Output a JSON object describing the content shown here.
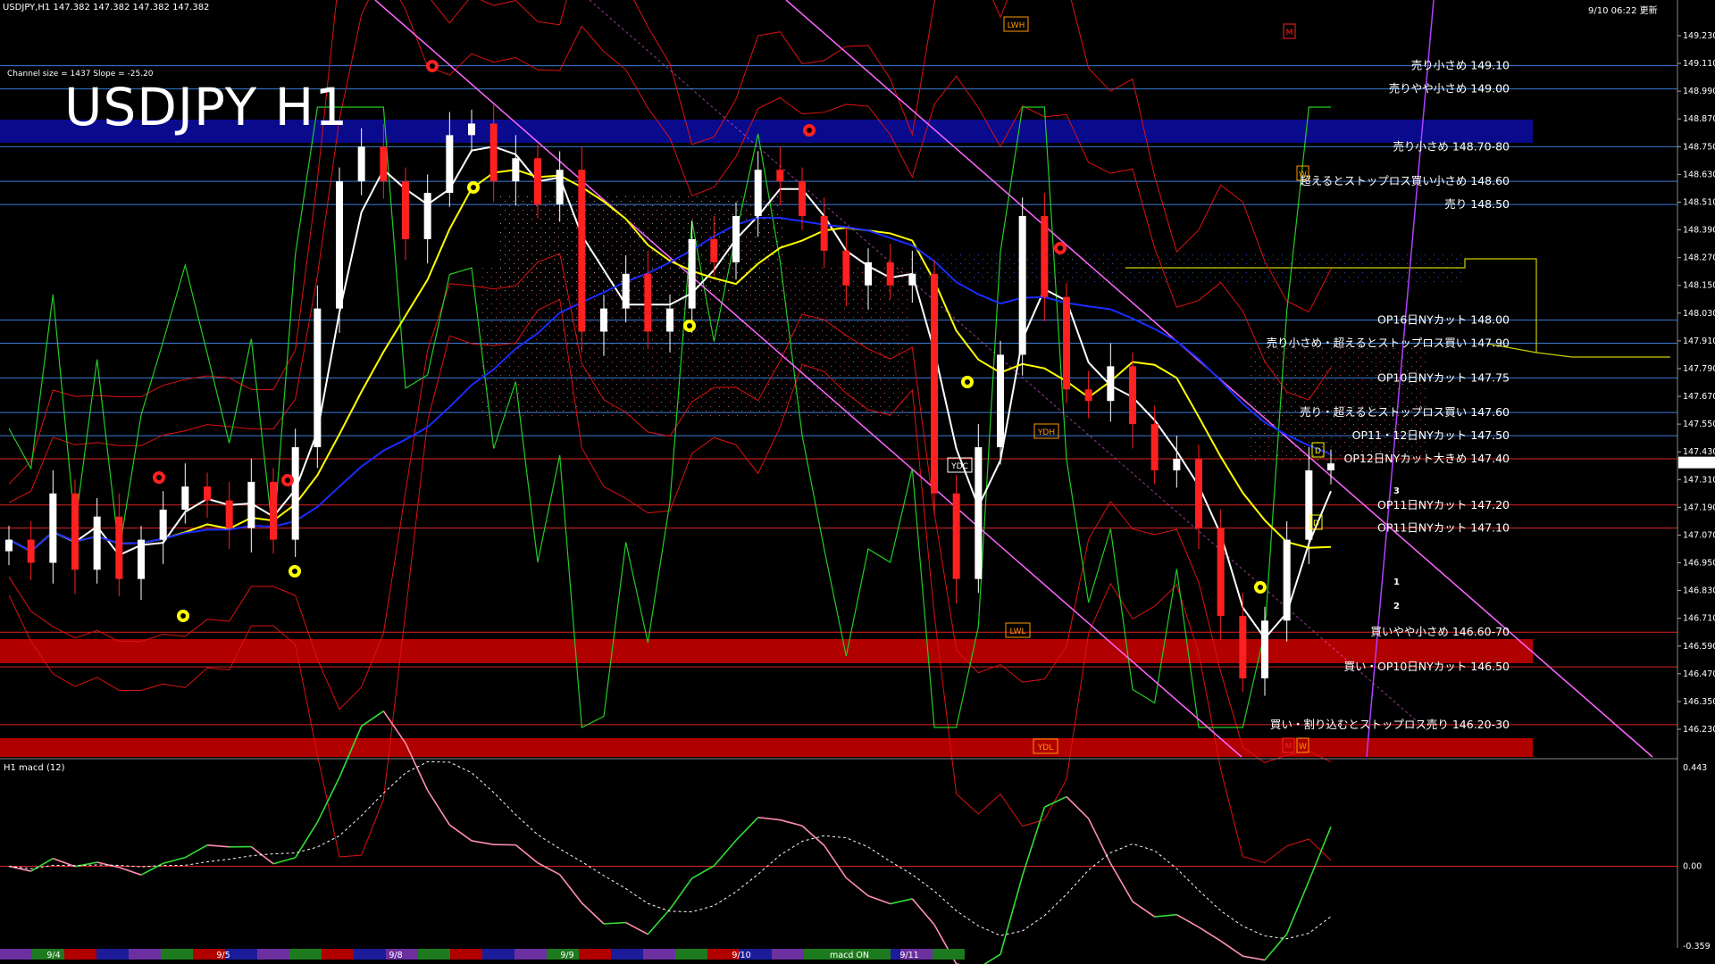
{
  "header": {
    "symbol_info": "USDJPY,H1 147.382 147.382 147.382 147.382",
    "updated": "9/10 06:22 更新",
    "channel_info": "Channel size = 1437 Slope = -25.20",
    "big_title": "USDJPY H1",
    "sub_panel_label": "H1 macd (12)"
  },
  "colors": {
    "background": "#000000",
    "bull_candle": "#ffffff",
    "bear_candle": "#ff2020",
    "sell_zone": "#0a0a8c",
    "buy_zone": "#b00000",
    "channel": "#ff66ff",
    "ma_white": "#ffffff",
    "ma_yellow": "#ffff00",
    "ma_blue": "#1a2cff",
    "bollinger": "#dd1111",
    "green_line": "#22cc22",
    "macd_main_up": "#33dd33",
    "macd_main_down": "#ff8fb0"
  },
  "chart_data": {
    "type": "candlestick",
    "title": "USDJPY H1",
    "ylim": [
      146.2,
      149.2
    ],
    "yaxis_ticks": [
      "149.230",
      "149.110",
      "148.990",
      "148.870",
      "148.750",
      "148.630",
      "148.510",
      "148.390",
      "148.270",
      "148.150",
      "148.030",
      "147.910",
      "147.790",
      "147.670",
      "147.550",
      "147.430",
      "147.310",
      "147.190",
      "147.070",
      "146.950",
      "146.830",
      "146.710",
      "146.590",
      "146.470",
      "146.350",
      "146.230"
    ],
    "current_price_label": "147.382",
    "date_labels": [
      "9/4",
      "9/5",
      "9/8",
      "9/9",
      "9/10",
      "9/11"
    ],
    "close_series": [
      147.05,
      146.95,
      147.25,
      146.92,
      147.15,
      146.88,
      147.05,
      147.18,
      147.28,
      147.22,
      147.1,
      147.3,
      147.05,
      147.45,
      148.05,
      148.6,
      148.75,
      148.6,
      148.35,
      148.55,
      148.8,
      148.85,
      148.6,
      148.7,
      148.5,
      148.65,
      147.95,
      148.05,
      148.2,
      147.95,
      148.05,
      148.35,
      148.25,
      148.45,
      148.65,
      148.6,
      148.45,
      148.3,
      148.15,
      148.25,
      148.15,
      148.2,
      147.25,
      146.88,
      147.45,
      147.85,
      148.45,
      148.1,
      147.7,
      147.65,
      147.8,
      147.55,
      147.35,
      147.4,
      147.1,
      146.72,
      146.45,
      146.7,
      147.05,
      147.35,
      147.38
    ],
    "price_levels": [
      {
        "price": 149.1,
        "label": "売り小さめ 149.10",
        "color": "#3a7bd5"
      },
      {
        "price": 149.0,
        "label": "売りやや小さめ 149.00",
        "color": "#3a7bd5"
      },
      {
        "price": 148.75,
        "label": "売り小さめ 148.70-80",
        "color": "#3a7bd5"
      },
      {
        "price": 148.6,
        "label": "超えるとストップロス買い小さめ 148.60",
        "color": "#3a7bd5"
      },
      {
        "price": 148.5,
        "label": "売り 148.50",
        "color": "#3a7bd5"
      },
      {
        "price": 148.0,
        "label": "OP16日NYカット 148.00",
        "color": "#3a7bd5"
      },
      {
        "price": 147.9,
        "label": "売り小さめ・超えるとストップロス買い 147.90",
        "color": "#3a7bd5"
      },
      {
        "price": 147.75,
        "label": "OP10日NYカット 147.75",
        "color": "#3a7bd5"
      },
      {
        "price": 147.6,
        "label": "売り・超えるとストップロス買い 147.60",
        "color": "#3a7bd5"
      },
      {
        "price": 147.5,
        "label": "OP11・12日NYカット 147.50",
        "color": "#3a7bd5"
      },
      {
        "price": 147.4,
        "label": "OP12日NYカット大きめ 147.40",
        "color": "#dd2222"
      },
      {
        "price": 147.2,
        "label": "OP11日NYカット 147.20",
        "color": "#dd2222"
      },
      {
        "price": 147.1,
        "label": "OP11日NYカット 147.10",
        "color": "#dd2222"
      },
      {
        "price": 146.65,
        "label": "買いやや小さめ 146.60-70",
        "color": "#dd2222"
      },
      {
        "price": 146.5,
        "label": "買い・OP10日NYカット 146.50",
        "color": "#dd2222"
      },
      {
        "price": 146.25,
        "label": "買い・割り込むとストップロス売り 146.20-30",
        "color": "#dd2222"
      }
    ],
    "markers": [
      "LWH",
      "M",
      "W",
      "YDC",
      "YDH",
      "LWL",
      "YDL",
      "D",
      "D",
      "M",
      "W"
    ],
    "wave_labels": [
      "3",
      "1",
      "2"
    ],
    "macd": {
      "ylim": [
        -0.359,
        0.443
      ],
      "ticks": [
        "0.443",
        "0.00",
        "-0.359"
      ],
      "legend": "macd ON"
    }
  }
}
